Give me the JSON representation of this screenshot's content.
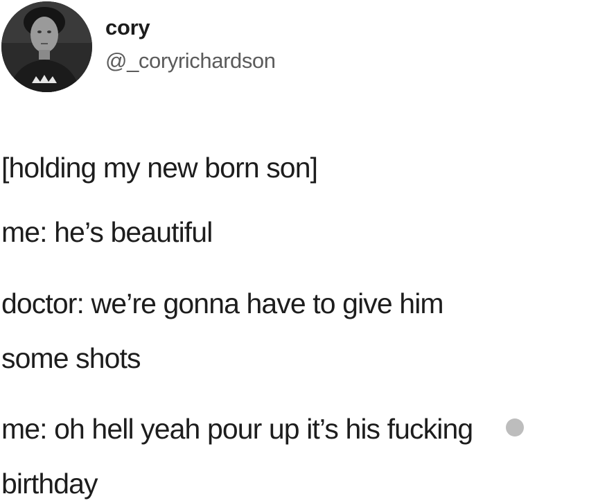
{
  "author": {
    "display_name": "cory",
    "handle": "@_coryrichardson",
    "avatar_icon": "profile-photo-icon"
  },
  "tweet": {
    "lines": [
      "[holding my new born son]",
      "me: he’s beautiful",
      "doctor: we’re gonna have to give him",
      "some shots",
      "me: oh hell yeah pour up it’s his fucking",
      "birthday"
    ]
  },
  "colors": {
    "background": "#ffffff",
    "text": "#1d1d1d",
    "handle": "#5b5b5b",
    "censor": "#bdbdbd"
  }
}
